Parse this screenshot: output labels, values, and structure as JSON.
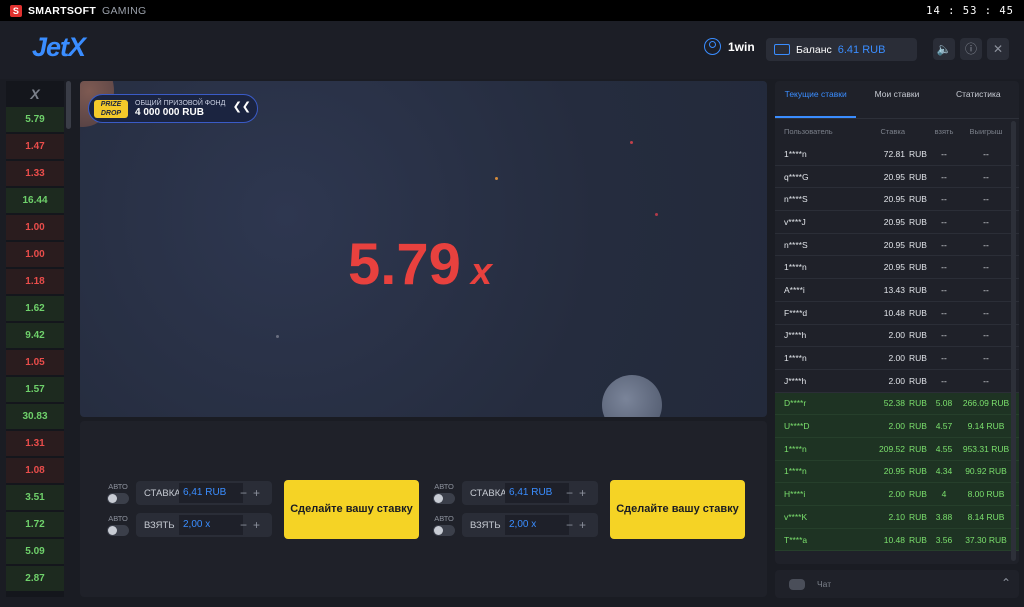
{
  "topbar": {
    "brand": "SMARTSOFT",
    "brand_suffix": "GAMING",
    "clock": "14 : 53 : 45"
  },
  "header": {
    "logo": "JetX",
    "username": "1win",
    "balance_label": "Баланс",
    "balance_value": "6.41 RUB"
  },
  "history": {
    "items": [
      {
        "v": "5.79",
        "c": "g"
      },
      {
        "v": "1.47",
        "c": "r"
      },
      {
        "v": "1.33",
        "c": "r"
      },
      {
        "v": "16.44",
        "c": "g"
      },
      {
        "v": "1.00",
        "c": "r"
      },
      {
        "v": "1.00",
        "c": "r"
      },
      {
        "v": "1.18",
        "c": "r"
      },
      {
        "v": "1.62",
        "c": "g"
      },
      {
        "v": "9.42",
        "c": "g"
      },
      {
        "v": "1.05",
        "c": "r"
      },
      {
        "v": "1.57",
        "c": "g"
      },
      {
        "v": "30.83",
        "c": "g"
      },
      {
        "v": "1.31",
        "c": "r"
      },
      {
        "v": "1.08",
        "c": "r"
      },
      {
        "v": "3.51",
        "c": "g"
      },
      {
        "v": "1.72",
        "c": "g"
      },
      {
        "v": "5.09",
        "c": "g"
      },
      {
        "v": "2.87",
        "c": "g"
      }
    ]
  },
  "game": {
    "prize_logo": "PRIZE DROP",
    "prize_title": "ОБЩИЙ ПРИЗОВОЙ ФОНД",
    "prize_amount": "4 000 000 RUB",
    "multiplier": "5.79",
    "multiplier_suffix": "x"
  },
  "bets": [
    {
      "auto_label": "АВТО",
      "stake_label": "СТАВКА",
      "stake_value": "6,41 RUB",
      "take_label": "ВЗЯТЬ",
      "take_value": "2,00 x",
      "button": "Сделайте вашу ставку"
    },
    {
      "auto_label": "АВТО",
      "stake_label": "СТАВКА",
      "stake_value": "6,41 RUB",
      "take_label": "ВЗЯТЬ",
      "take_value": "2,00 x",
      "button": "Сделайте вашу ставку"
    }
  ],
  "side": {
    "tabs": [
      "Текущие ставки",
      "Мои ставки",
      "Статистика"
    ],
    "columns": [
      "Пользователь",
      "Ставка",
      "взять",
      "Выигрыш"
    ],
    "rows": [
      {
        "u": "1****n",
        "s": "72.81",
        "k": "--",
        "w": "--",
        "win": false
      },
      {
        "u": "q****G",
        "s": "20.95",
        "k": "--",
        "w": "--",
        "win": false
      },
      {
        "u": "n****S",
        "s": "20.95",
        "k": "--",
        "w": "--",
        "win": false
      },
      {
        "u": "v****J",
        "s": "20.95",
        "k": "--",
        "w": "--",
        "win": false
      },
      {
        "u": "n****S",
        "s": "20.95",
        "k": "--",
        "w": "--",
        "win": false
      },
      {
        "u": "1****n",
        "s": "20.95",
        "k": "--",
        "w": "--",
        "win": false
      },
      {
        "u": "A****i",
        "s": "13.43",
        "k": "--",
        "w": "--",
        "win": false
      },
      {
        "u": "F****d",
        "s": "10.48",
        "k": "--",
        "w": "--",
        "win": false
      },
      {
        "u": "J****h",
        "s": "2.00",
        "k": "--",
        "w": "--",
        "win": false
      },
      {
        "u": "1****n",
        "s": "2.00",
        "k": "--",
        "w": "--",
        "win": false
      },
      {
        "u": "J****h",
        "s": "2.00",
        "k": "--",
        "w": "--",
        "win": false
      },
      {
        "u": "D****r",
        "s": "52.38",
        "k": "5.08",
        "w": "266.09 RUB",
        "win": true
      },
      {
        "u": "U****D",
        "s": "2.00",
        "k": "4.57",
        "w": "9.14 RUB",
        "win": true
      },
      {
        "u": "1****n",
        "s": "209.52",
        "k": "4.55",
        "w": "953.31 RUB",
        "win": true
      },
      {
        "u": "1****n",
        "s": "20.95",
        "k": "4.34",
        "w": "90.92 RUB",
        "win": true
      },
      {
        "u": "H****i",
        "s": "2.00",
        "k": "4",
        "w": "8.00 RUB",
        "win": true
      },
      {
        "u": "v****K",
        "s": "2.10",
        "k": "3.88",
        "w": "8.14 RUB",
        "win": true
      },
      {
        "u": "T****a",
        "s": "10.48",
        "k": "3.56",
        "w": "37.30 RUB",
        "win": true
      }
    ],
    "currency": "RUB",
    "chat_label": "Чат"
  }
}
